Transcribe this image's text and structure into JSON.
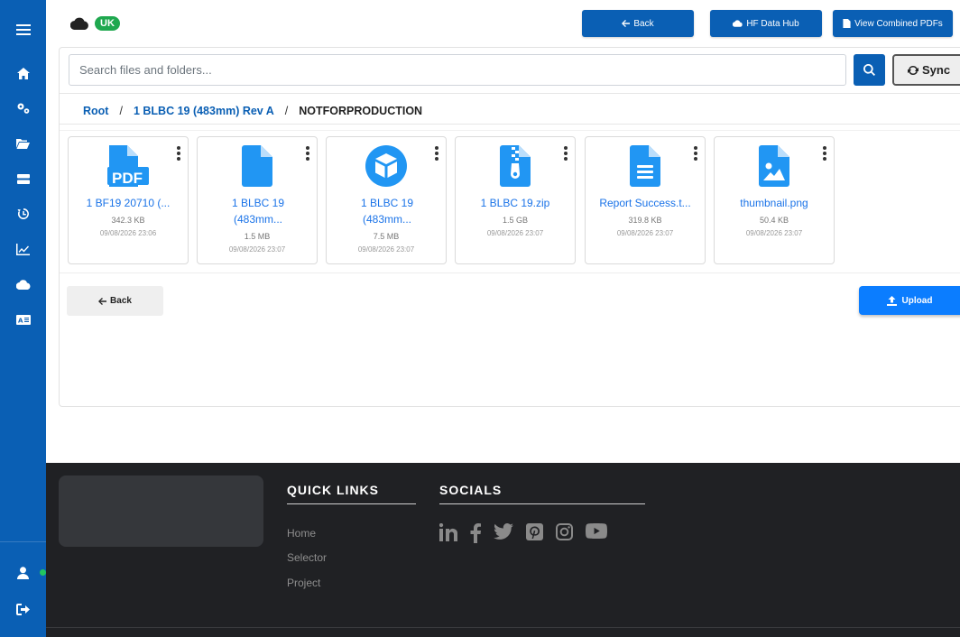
{
  "header": {
    "region_badge": "UK",
    "buttons": {
      "back": "Back",
      "data_hub": "HF Data Hub",
      "combined_pdfs": "View Combined PDFs"
    }
  },
  "search": {
    "placeholder": "Search files and folders...",
    "sync_label": "Sync"
  },
  "breadcrumb": {
    "root": "Root",
    "separator": "/",
    "folder": "1 BLBC 19 (483mm) Rev A",
    "current": "NOTFORPRODUCTION"
  },
  "files": [
    {
      "icon": "pdf-file-icon",
      "name": "1 BF19 20710 (...",
      "size": "342.3 KB",
      "date": "09/08/2026 23:06"
    },
    {
      "icon": "file-icon",
      "name": "1 BLBC 19 (483mm...",
      "size": "1.5 MB",
      "date": "09/08/2026 23:07"
    },
    {
      "icon": "cube-icon",
      "name": "1 BLBC 19 (483mm...",
      "size": "7.5 MB",
      "date": "09/08/2026 23:07"
    },
    {
      "icon": "zip-file-icon",
      "name": "1 BLBC 19.zip",
      "size": "1.5 GB",
      "date": "09/08/2026 23:07"
    },
    {
      "icon": "text-file-icon",
      "name": "Report Success.t...",
      "size": "319.8 KB",
      "date": "09/08/2026 23:07"
    },
    {
      "icon": "image-file-icon",
      "name": "thumbnail.png",
      "size": "50.4 KB",
      "date": "09/08/2026 23:07"
    }
  ],
  "actions": {
    "back": "Back",
    "upload": "Upload"
  },
  "footer": {
    "quick_links_title": "QUICK LINKS",
    "quick_links": [
      "Home",
      "Selector",
      "Project"
    ],
    "socials_title": "SOCIALS",
    "socials": [
      "linkedin-icon",
      "facebook-icon",
      "twitter-icon",
      "pinterest-icon",
      "instagram-icon",
      "youtube-icon"
    ]
  },
  "colors": {
    "primary": "#0a5fb4",
    "upload": "#0b7dff",
    "file_icon": "#2196f3",
    "badge": "#1fa84f",
    "footer_bg": "#202124"
  }
}
